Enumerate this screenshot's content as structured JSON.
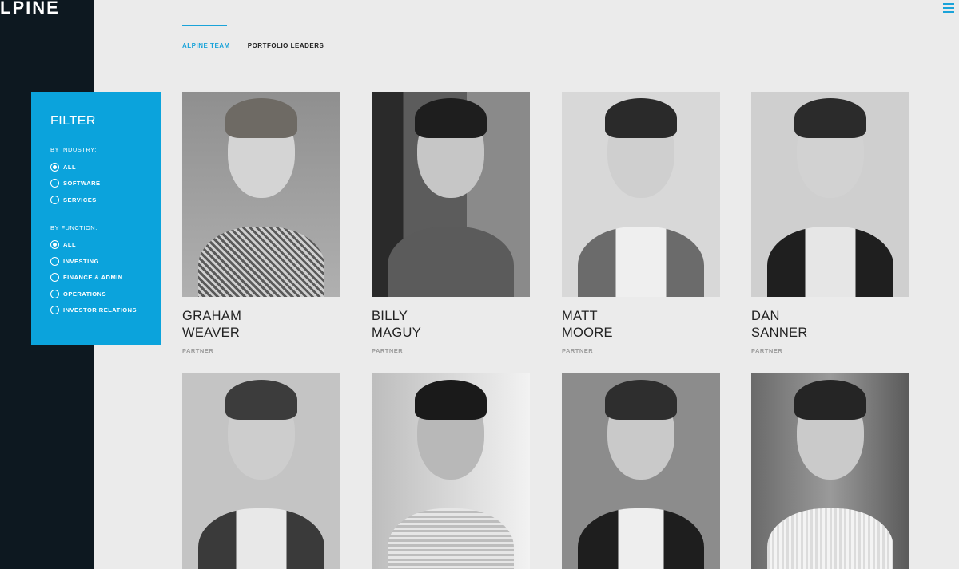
{
  "brand": {
    "logo_text": "LPINE"
  },
  "tabs": [
    {
      "label": "ALPINE TEAM",
      "active": true
    },
    {
      "label": "PORTFOLIO LEADERS",
      "active": false
    }
  ],
  "filter": {
    "title": "FILTER",
    "industry": {
      "label": "BY INDUSTRY:",
      "options": [
        {
          "label": "ALL",
          "checked": true
        },
        {
          "label": "SOFTWARE",
          "checked": false
        },
        {
          "label": "SERVICES",
          "checked": false
        }
      ]
    },
    "function": {
      "label": "BY FUNCTION:",
      "options": [
        {
          "label": "ALL",
          "checked": true
        },
        {
          "label": "INVESTING",
          "checked": false
        },
        {
          "label": "FINANCE & ADMIN",
          "checked": false
        },
        {
          "label": "OPERATIONS",
          "checked": false
        },
        {
          "label": "INVESTOR RELATIONS",
          "checked": false
        }
      ]
    }
  },
  "team": [
    {
      "first": "GRAHAM",
      "last": "WEAVER",
      "role": "PARTNER"
    },
    {
      "first": "BILLY",
      "last": "MAGUY",
      "role": "PARTNER"
    },
    {
      "first": "MATT",
      "last": "MOORE",
      "role": "PARTNER"
    },
    {
      "first": "DAN",
      "last": "SANNER",
      "role": "PARTNER"
    },
    {
      "first": "",
      "last": "",
      "role": ""
    },
    {
      "first": "",
      "last": "",
      "role": ""
    },
    {
      "first": "",
      "last": "",
      "role": ""
    },
    {
      "first": "",
      "last": "",
      "role": ""
    }
  ],
  "colors": {
    "accent": "#0ba3dc",
    "sidebar": "#0d1820",
    "background": "#ebebeb"
  }
}
